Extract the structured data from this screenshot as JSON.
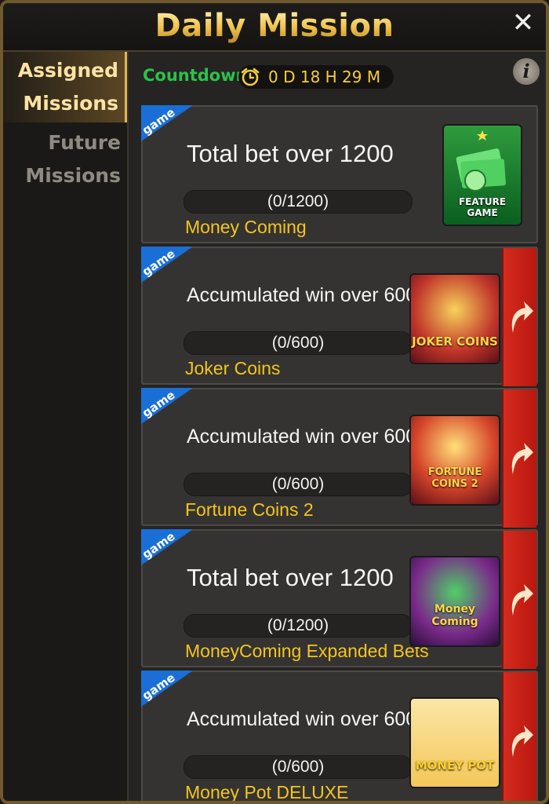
{
  "header": {
    "title": "Daily Mission",
    "close_glyph": "✕"
  },
  "sidebar": {
    "tabs": [
      {
        "line1": "Assigned",
        "line2": "Missions",
        "active": true
      },
      {
        "line1": "Future",
        "line2": "Missions",
        "active": false
      }
    ]
  },
  "countdown": {
    "label": "Countdown",
    "value": "0 D 18 H 29 M",
    "icon": "alarm-clock-icon"
  },
  "info": {
    "glyph": "i"
  },
  "badge_text": "game",
  "missions": [
    {
      "task": "Total bet over 1200",
      "progress": "(0/1200)",
      "game": "Money Coming",
      "thumb_caption": "FEATURE GAME",
      "has_go": false
    },
    {
      "task": "Accumulated win over 600",
      "progress": "(0/600)",
      "game": "Joker Coins",
      "thumb_caption": "JOKER COINS",
      "has_go": true
    },
    {
      "task": "Accumulated win over 600",
      "progress": "(0/600)",
      "game": "Fortune Coins 2",
      "thumb_caption": "FORTUNE COINS 2",
      "has_go": true
    },
    {
      "task": "Total bet over 1200",
      "progress": "(0/1200)",
      "game": "MoneyComing Expanded Bets",
      "thumb_caption": "Money Coming",
      "has_go": true
    },
    {
      "task": "Accumulated win over 600",
      "progress": "(0/600)",
      "game": "Money Pot DELUXE",
      "thumb_caption": "MONEY POT",
      "has_go": true
    }
  ],
  "colors": {
    "accent_gold": "#e3b454",
    "countdown_green": "#2bc24a",
    "game_name_yellow": "#f3c51f",
    "go_red": "#d42b1e",
    "badge_blue": "#1a6fd6"
  }
}
